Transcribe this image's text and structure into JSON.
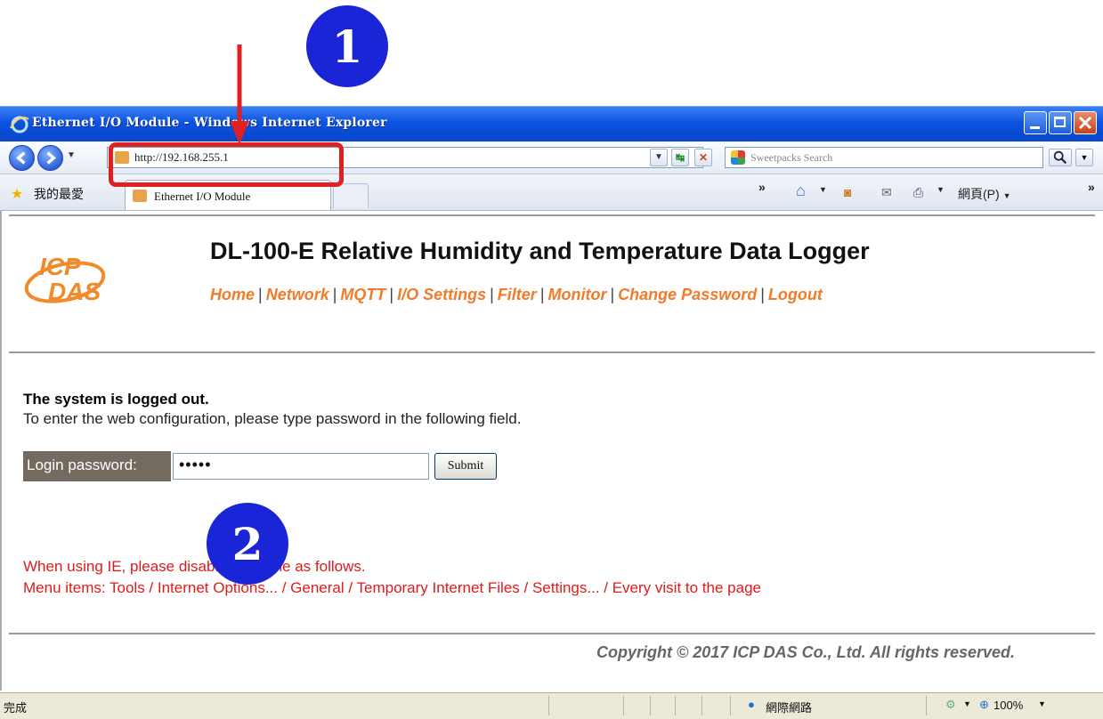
{
  "annotation": {
    "top_cut_text": "",
    "badge1": "1",
    "badge2": "2",
    "arrow_color": "#e02020",
    "highlight_color": "#e02020"
  },
  "window": {
    "title": "Ethernet I/O Module - Windows Internet Explorer",
    "address_url": "http://192.168.255.1",
    "search_placeholder": "Sweetpacks Search",
    "favorites_label": "我的最愛",
    "tab_label": "Ethernet I/O Module",
    "page_menu_label": "網頁(P)",
    "status_done": "完成",
    "status_zone": "網際網路",
    "zoom": "100%"
  },
  "page": {
    "heading": "DL-100-E Relative Humidity and Temperature Data Logger",
    "logo_text_top": "ICP",
    "logo_text_bottom": "DAS",
    "menu": [
      "Home",
      "Network",
      "MQTT",
      "I/O Settings",
      "Filter",
      "Monitor",
      "Change Password",
      "Logout"
    ],
    "logged_out_title": "The system is logged out.",
    "logged_out_text": "To enter the web configuration, please type password in the following field.",
    "password_label": "Login password:",
    "password_value": "•••••",
    "submit_label": "Submit",
    "ie_note_line1": "When using IE, please disable its cache as follows.",
    "ie_note_line2": "Menu items: Tools / Internet Options... / General / Temporary Internet Files / Settings... / Every visit to the page",
    "copyright": "Copyright © 2017 ICP DAS Co., Ltd. All rights reserved.",
    "accent_color": "#f07b2a"
  }
}
